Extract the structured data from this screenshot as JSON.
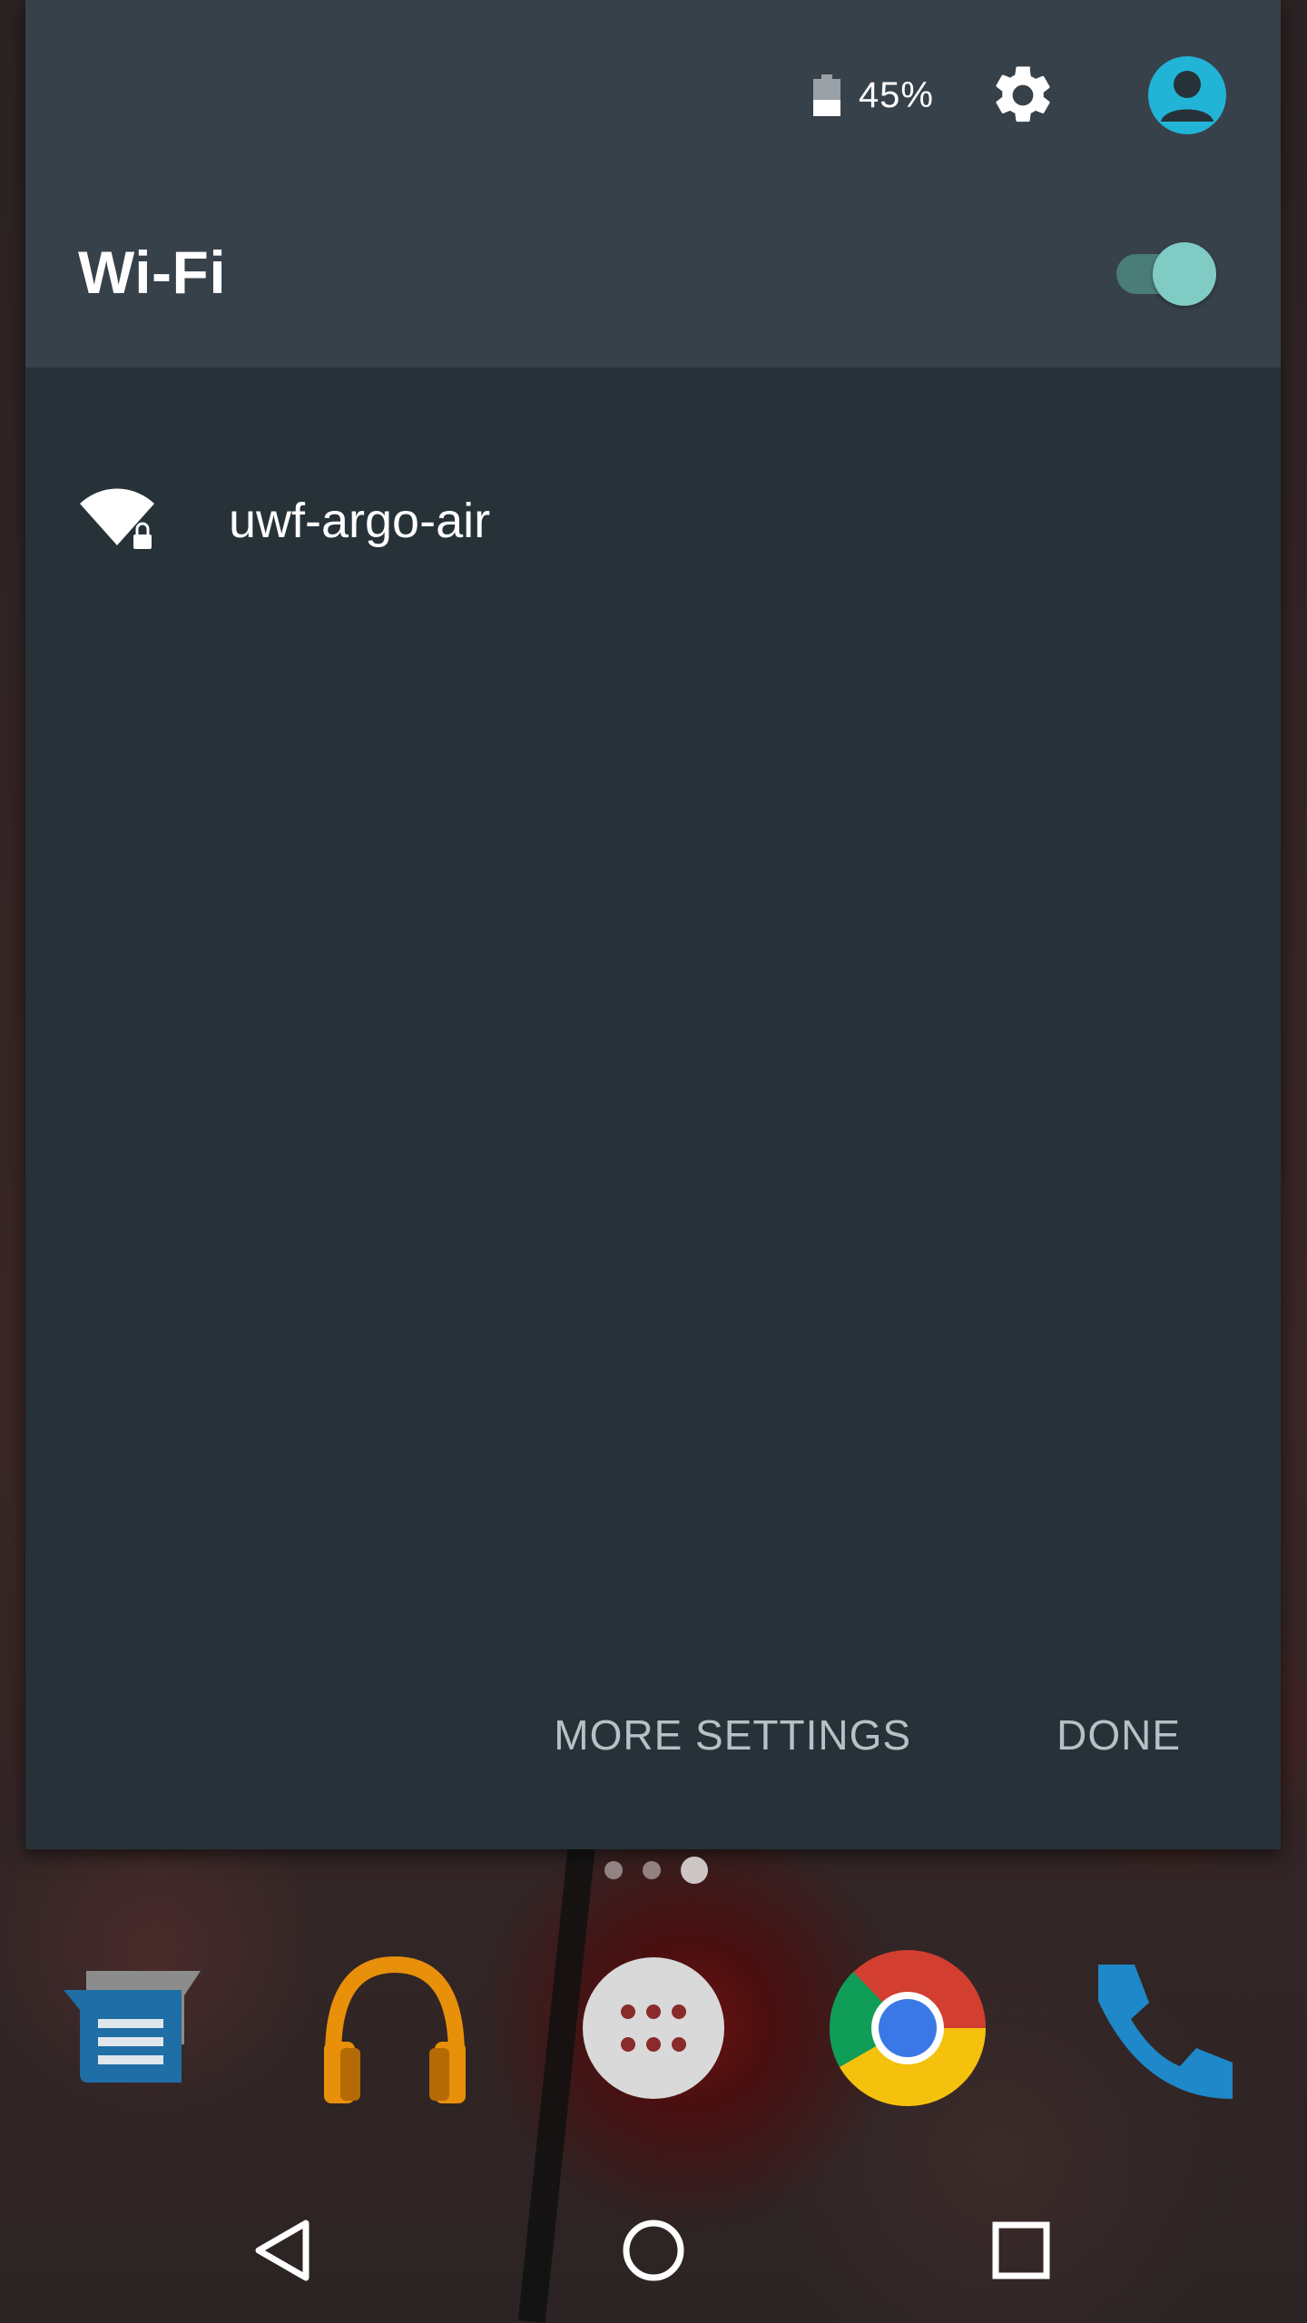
{
  "status": {
    "battery_percent": 45,
    "battery_text": "45%",
    "settings_icon": "gear-icon",
    "user_icon": "account-icon",
    "user_icon_color": "#22b4d6"
  },
  "wifi": {
    "title": "Wi-Fi",
    "enabled": true,
    "toggle_color": "#80cbc4"
  },
  "networks": [
    {
      "name": "uwf-argo-air",
      "icon": "wifi-lock-icon",
      "secured": true
    }
  ],
  "actions": {
    "more_settings": "MORE SETTINGS",
    "done": "DONE"
  },
  "launcher": {
    "pages": 3,
    "active_page": 3,
    "dock_apps": [
      "messenger-icon",
      "play-music-icon",
      "app-drawer-icon",
      "chrome-icon",
      "phone-icon"
    ]
  },
  "navbar": {
    "buttons": [
      "back-icon",
      "home-icon",
      "recents-icon"
    ]
  },
  "colors": {
    "panel_bg": "#263238",
    "header_bg": "#37414a",
    "action_text": "#b7c0c6"
  }
}
